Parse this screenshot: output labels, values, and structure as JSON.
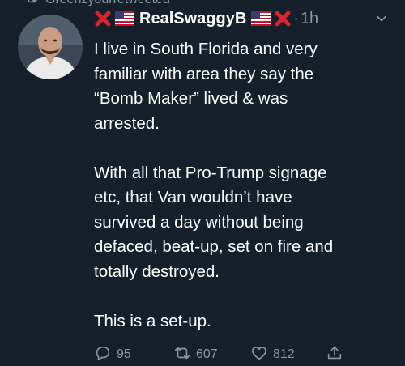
{
  "retweet_context": {
    "text": "Greenzyourretweeted"
  },
  "tweet": {
    "author_name": "RealSwaggyB",
    "separator": "·",
    "time": "1h",
    "text": "I live in South Florida and very\nfamiliar with area they say the\n“Bomb Maker” lived & was\narrested.\n\nWith all that Pro-Trump signage\netc, that Van wouldn’t have\nsurvived a day without being\ndefaced, beat-up, set on fire and\ntotally destroyed.\n\nThis is a set-up."
  },
  "actions": {
    "replies": "95",
    "retweets": "607",
    "likes": "812"
  },
  "colors": {
    "background": "#15202b",
    "secondary_text": "#8899a6",
    "primary_text": "#ffffff",
    "x_mark": "#d9252b"
  },
  "icons": [
    "retweet-icon",
    "cross-mark-icon",
    "us-flag-icon",
    "chevron-down-icon",
    "reply-icon",
    "like-icon",
    "share-icon"
  ]
}
